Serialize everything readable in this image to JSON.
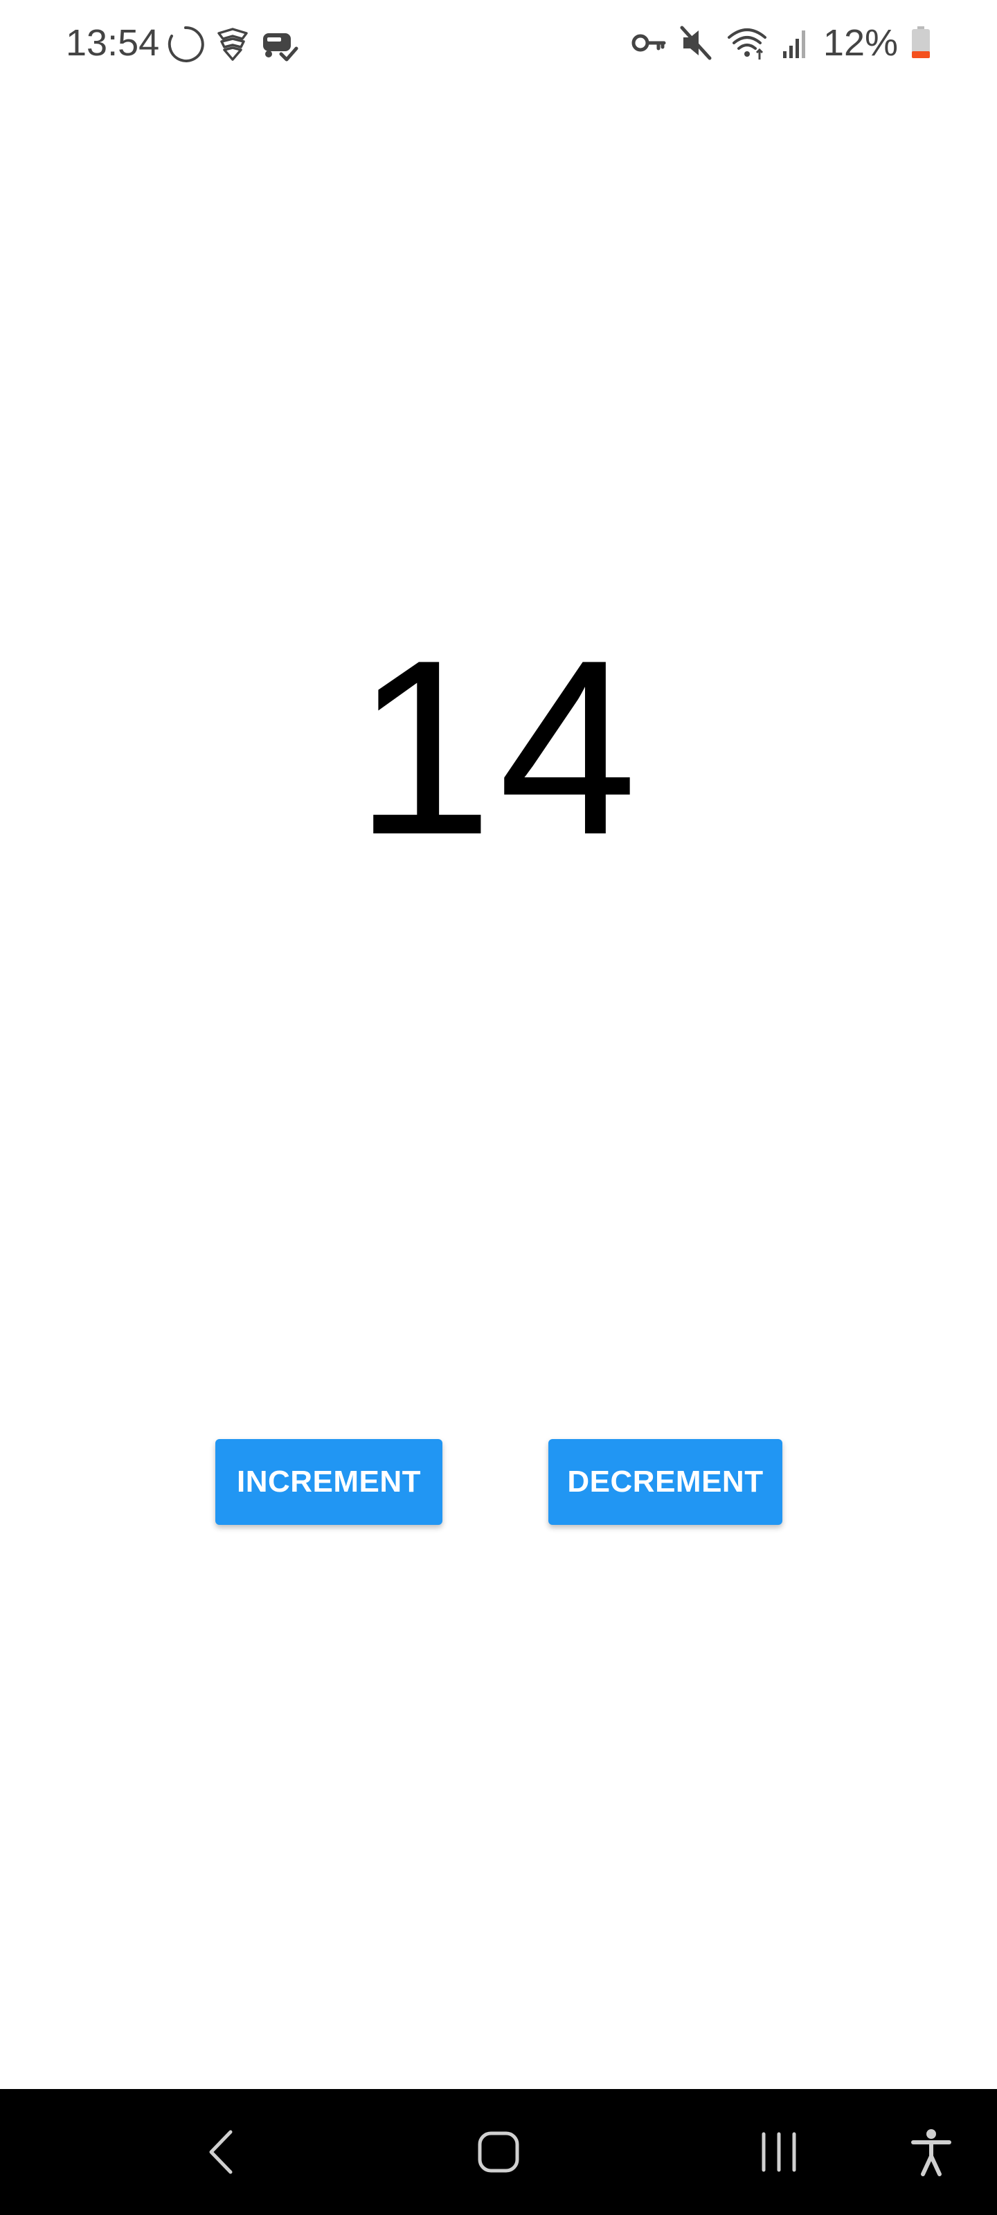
{
  "status_bar": {
    "time": "13:54",
    "battery": "12%",
    "left_icons": [
      "loading-circle-icon",
      "shield-stack-icon",
      "car-check-icon"
    ],
    "right_icons": [
      "key-icon",
      "mute-icon",
      "wifi-icon",
      "signal-icon",
      "battery-low-icon"
    ]
  },
  "counter": {
    "value": "14"
  },
  "buttons": {
    "increment_label": "INCREMENT",
    "decrement_label": "DECREMENT"
  },
  "navigation": {
    "icons": [
      "back-icon",
      "home-icon",
      "recents-icon",
      "accessibility-icon"
    ]
  },
  "colors": {
    "button_bg": "#2196f3",
    "button_text": "#ffffff",
    "counter_text": "#000000",
    "nav_bar_bg": "#000000",
    "status_text": "#444444",
    "battery_low": "#f4511e"
  }
}
